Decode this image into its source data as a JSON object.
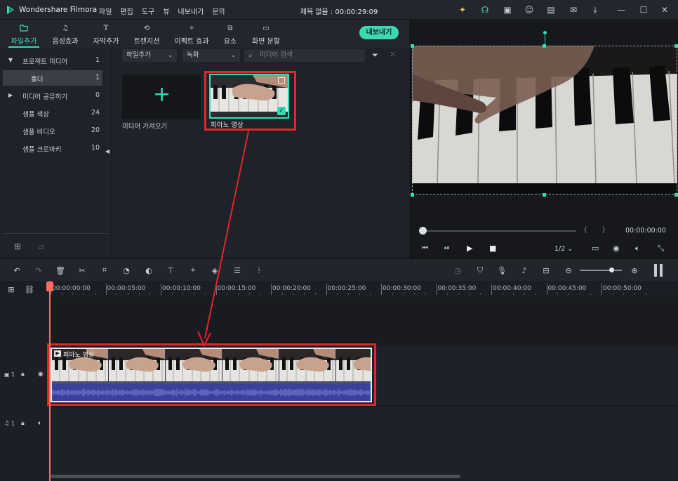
{
  "app": {
    "name": "Wondershare Filmora",
    "window_title": "제목 없음 : 00:00:29:09",
    "menu": [
      "파일",
      "편집",
      "도구",
      "뷰",
      "내보내기",
      "문의"
    ]
  },
  "tabs": [
    {
      "label": "파일추가",
      "icon": "folder-icon",
      "active": true
    },
    {
      "label": "음성효과",
      "icon": "music-note-icon"
    },
    {
      "label": "자막추가",
      "icon": "text-icon"
    },
    {
      "label": "트랜지션",
      "icon": "transition-icon"
    },
    {
      "label": "이펙트 효과",
      "icon": "sparkle-icon"
    },
    {
      "label": "요소",
      "icon": "elements-icon"
    },
    {
      "label": "화면 분할",
      "icon": "split-screen-icon"
    }
  ],
  "export_label": "내보내기",
  "sidebar": {
    "items": [
      {
        "label": "프로젝트 미디어",
        "count": "1",
        "arrow": "▼"
      },
      {
        "label": "폴더",
        "count": "1",
        "selected": true
      },
      {
        "label": "미디어 공유하기",
        "count": "0",
        "arrow": "▶"
      },
      {
        "label": "샘플 색상",
        "count": "24"
      },
      {
        "label": "샘플 비디오",
        "count": "20"
      },
      {
        "label": "샘플 크로마키",
        "count": "10"
      }
    ]
  },
  "media": {
    "import_dropdown": "파일추가",
    "record_dropdown": "녹화",
    "search_placeholder": "미디어 검색",
    "import_tile_label": "미디어 가져오기",
    "clip_label": "피아노 영상"
  },
  "preview": {
    "timecode": "00:00:00:00",
    "bracket_in": "{",
    "bracket_out": "}",
    "quality": "1/2",
    "progress": 0
  },
  "timeline": {
    "ruler": [
      "00:00:00:00",
      "00:00:05:00",
      "00:00:10:00",
      "00:00:15:00",
      "00:00:20:00",
      "00:00:25:00",
      "00:00:30:00",
      "00:00:35:00",
      "00:00:40:00",
      "00:00:45:00",
      "00:00:50:00"
    ],
    "video_track_label": "1",
    "audio_track_label": "1",
    "clip_title": "피아노 영상",
    "zoom": 0.75
  },
  "colors": {
    "accent": "#38d9b5",
    "highlight": "#e1262c",
    "playhead": "#ff6b5d"
  }
}
